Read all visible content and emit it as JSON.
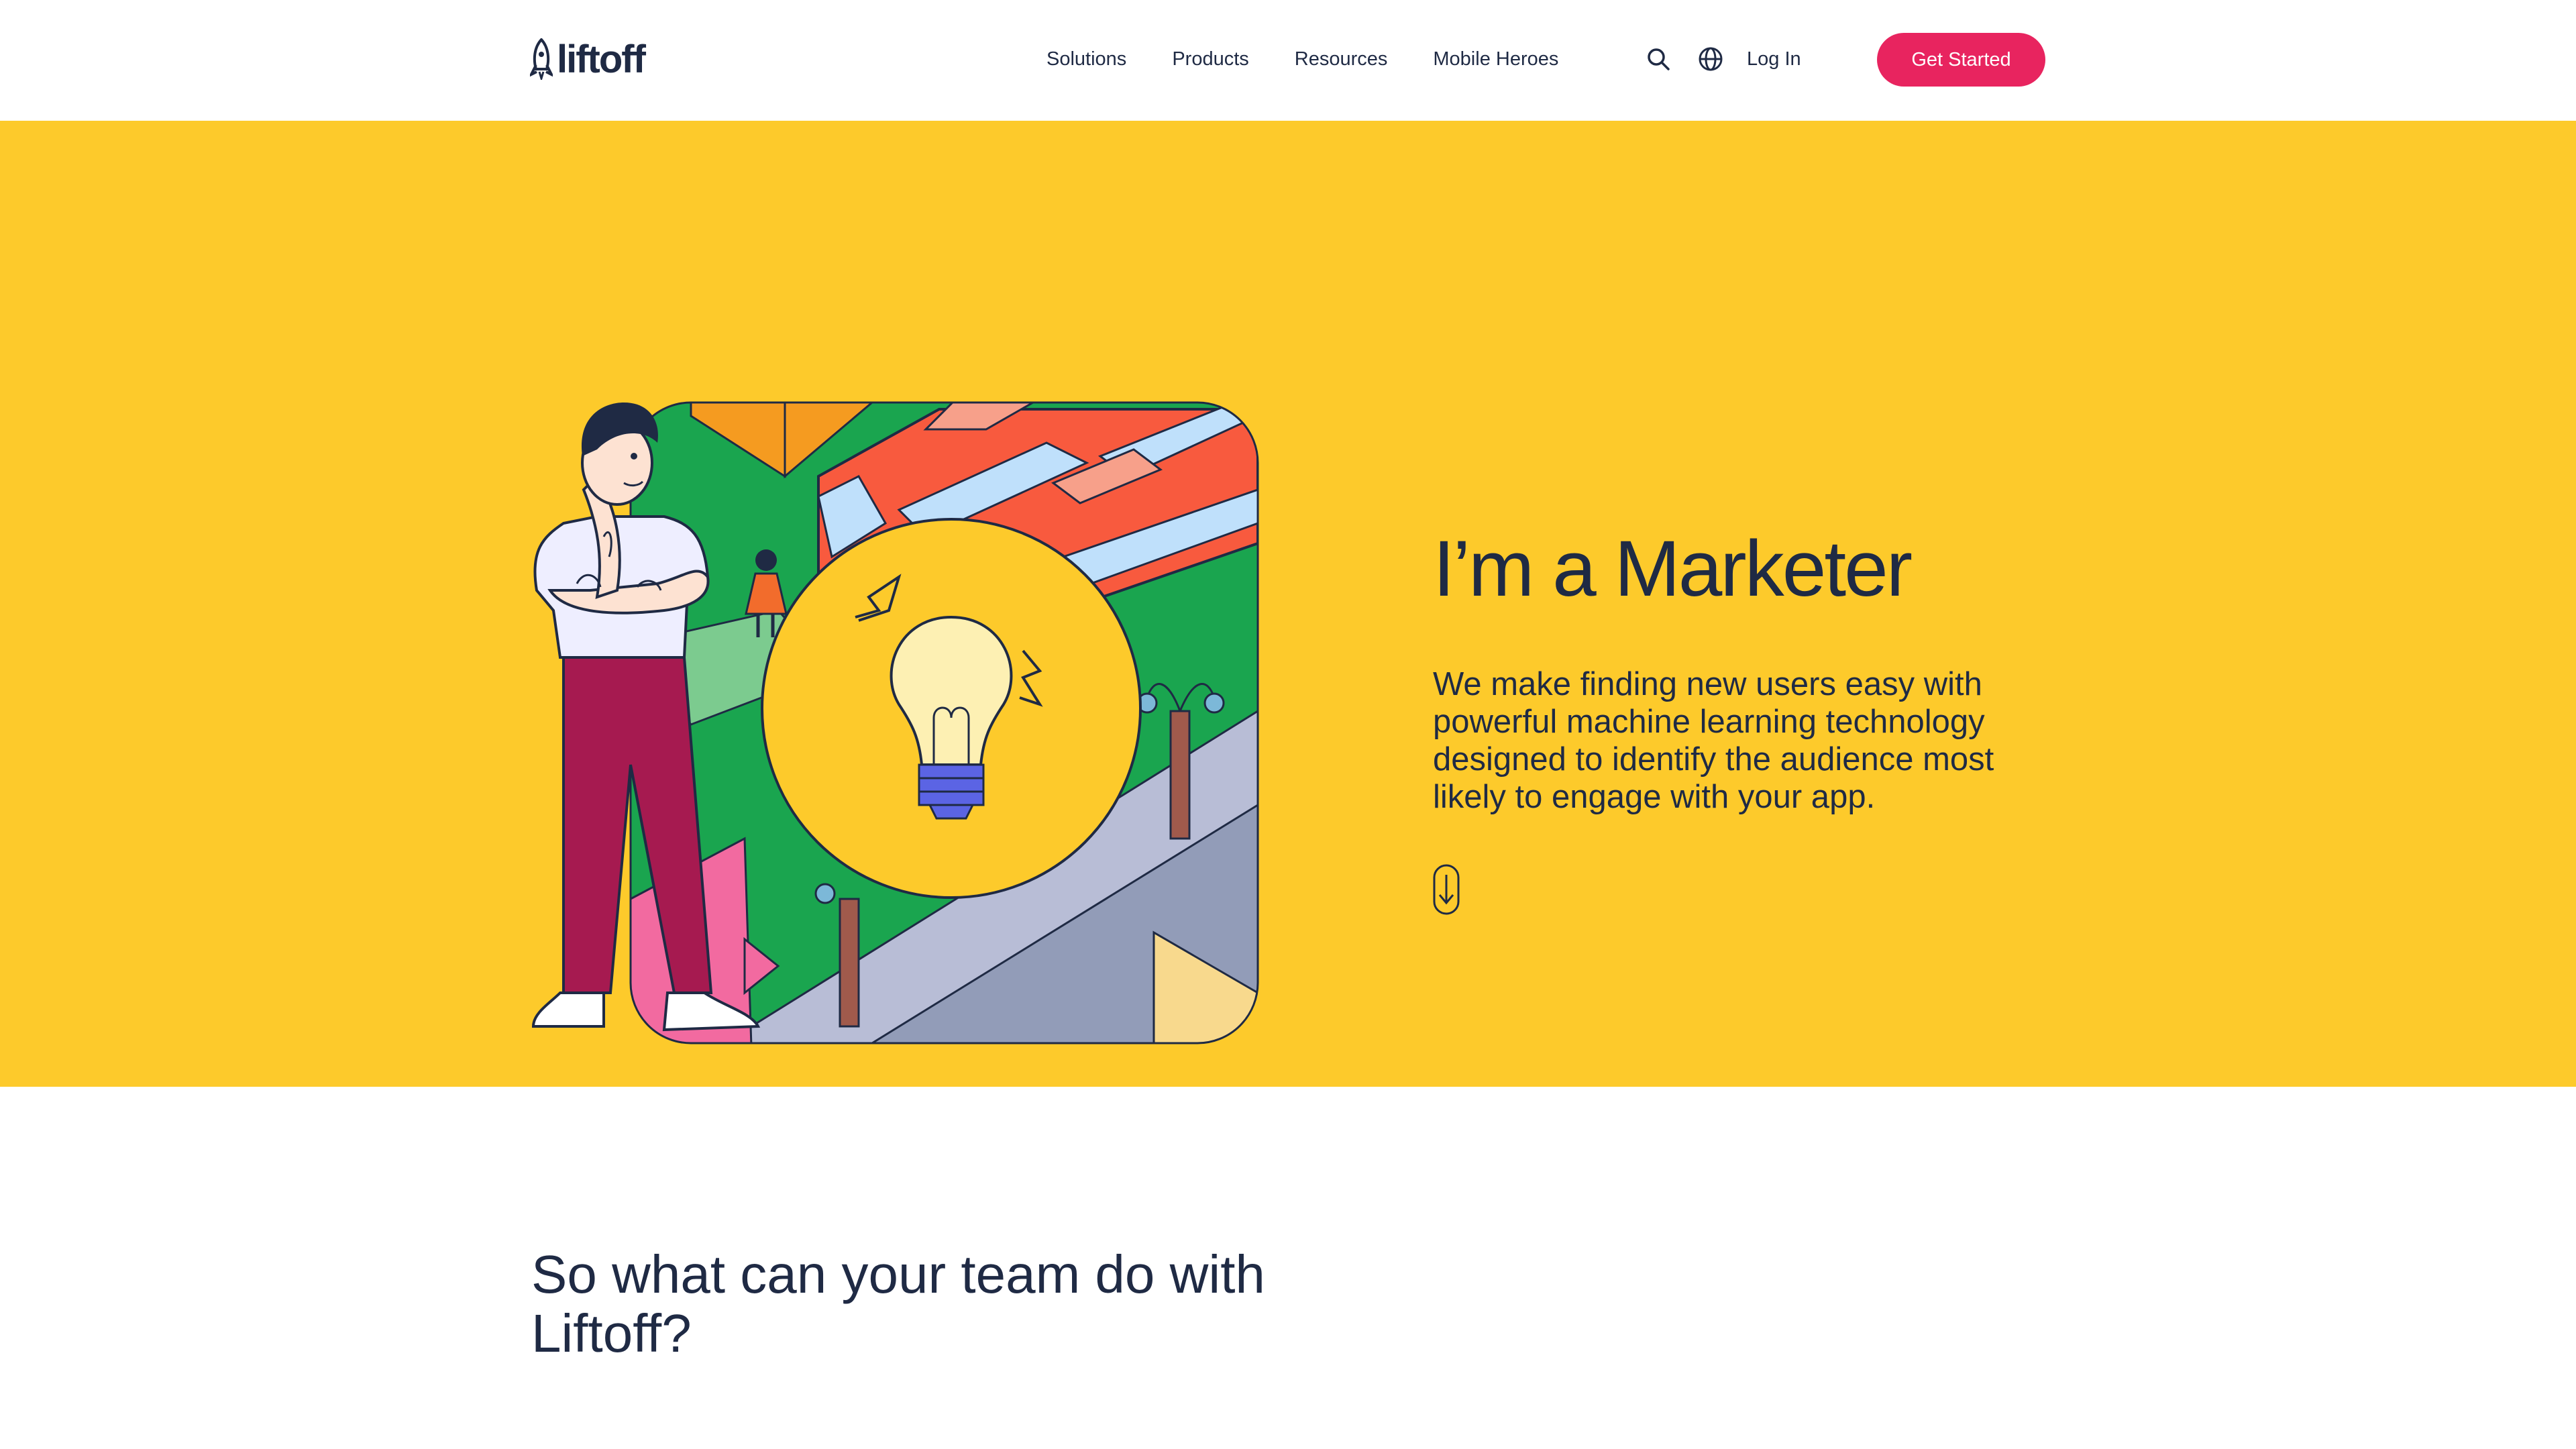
{
  "header": {
    "logo_text": "liftoff",
    "nav": [
      "Solutions",
      "Products",
      "Resources",
      "Mobile Heroes"
    ],
    "search_icon": "search-icon",
    "language_icon": "globe-icon",
    "login_label": "Log In",
    "cta_label": "Get Started"
  },
  "hero": {
    "title": "I’m a Marketer",
    "body": "We make finding new users easy with powerful machine learning technology designed to identify the audience most likely to engage with your app.",
    "scroll_icon": "arrow-down-icon"
  },
  "section": {
    "title": "So what can your team do with Liftoff?"
  },
  "colors": {
    "hero_bg": "#fdca2b",
    "cta_bg": "#e8245f",
    "text": "#1f2a44"
  }
}
